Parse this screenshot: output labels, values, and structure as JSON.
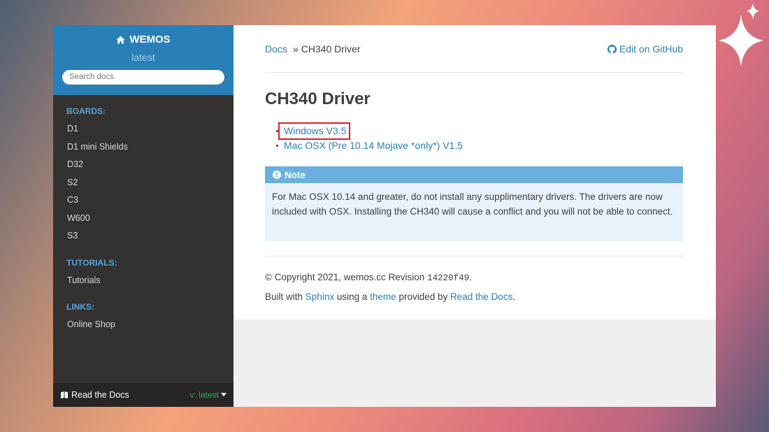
{
  "sidebar": {
    "brand": "WEMOS",
    "version": "latest",
    "search_placeholder": "Search docs",
    "sections": [
      {
        "caption": "BOARDS:",
        "items": [
          "D1",
          "D1 mini Shields",
          "D32",
          "S2",
          "C3",
          "W600",
          "S3"
        ]
      },
      {
        "caption": "TUTORIALS:",
        "items": [
          "Tutorials"
        ]
      },
      {
        "caption": "LINKS:",
        "items": [
          "Online Shop"
        ]
      }
    ],
    "footer": {
      "rtd_label": "Read the Docs",
      "version_label": "v: latest"
    }
  },
  "breadcrumb": {
    "root": "Docs",
    "separator": "»",
    "current": "CH340 Driver",
    "edit": "Edit on GitHub"
  },
  "page": {
    "title": "CH340 Driver",
    "links": [
      "Windows V3.5",
      "Mac OSX (Pre 10.14 Mojave *only*) V1.5"
    ],
    "note": {
      "title": "Note",
      "body": "For Mac OSX 10.14 and greater, do not install any supplimentary drivers. The drivers are now included with OSX. Installing the CH340 will cause a conflict and you will not be able to connect."
    }
  },
  "footer": {
    "copyright": "© Copyright 2021, wemos.cc Revision",
    "revision": "14220f49",
    "revision_end": ".",
    "built_with": "Built with",
    "sphinx": "Sphinx",
    "using_a": "using a",
    "theme": "theme",
    "provided_by": "provided by",
    "rtd": "Read the Docs",
    "end": "."
  },
  "colors": {
    "accent": "#2980b9",
    "sidebar_bg": "#343131",
    "note_header": "#6ab0de",
    "highlight": "#d9202c"
  }
}
